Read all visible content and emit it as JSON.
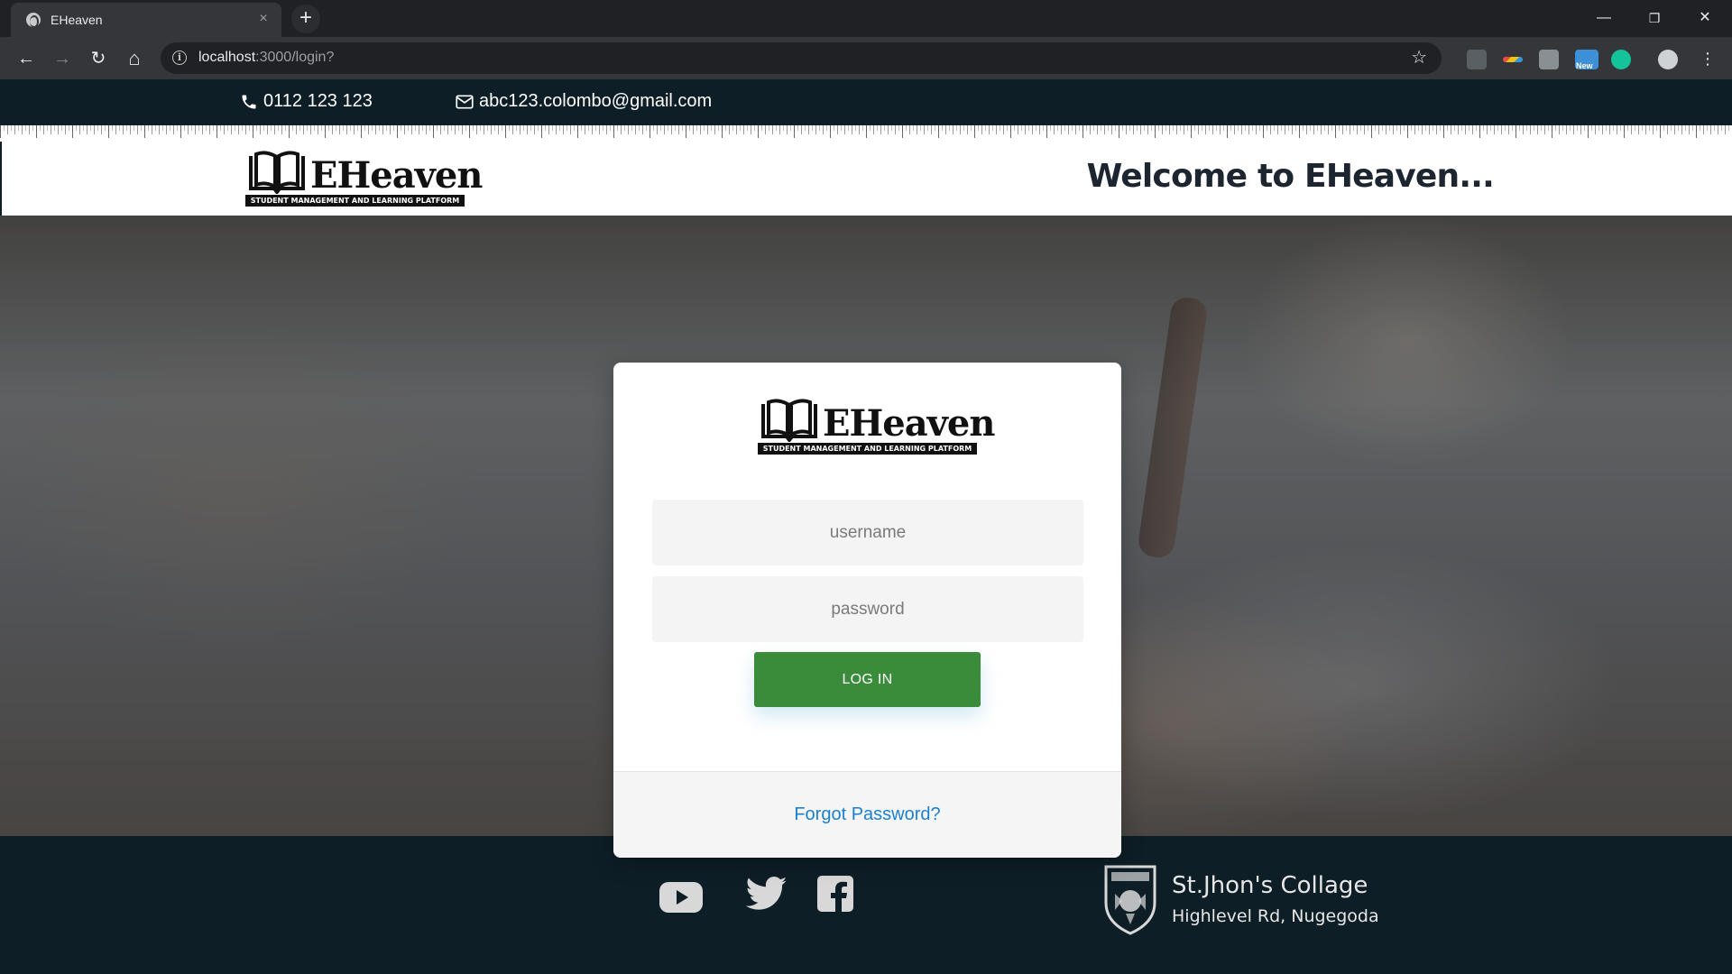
{
  "browser": {
    "tab_title": "EHeaven",
    "tab_close": "×",
    "new_tab": "+",
    "url_host": "localhost",
    "url_path": ":3000/login?",
    "window_controls": {
      "minimize": "—",
      "restore": "❐",
      "close": "✕"
    },
    "nav": {
      "back": "←",
      "forward": "→",
      "reload": "↻",
      "home": "⌂"
    },
    "extensions": [
      "selenium-ide-extension",
      "color-picker-extension",
      "clipboard-extension",
      "new-badge-extension",
      "grammarly-extension",
      "globe-extension"
    ],
    "new_badge": "New"
  },
  "contact": {
    "phone": "0112 123 123",
    "email": "abc123.colombo@gmail.com"
  },
  "header": {
    "logo_word": "EHeaven",
    "logo_tagline": "STUDENT MANAGEMENT AND LEARNING PLATFORM",
    "welcome": "Welcome to EHeaven..."
  },
  "login": {
    "logo_word": "EHeaven",
    "logo_tagline": "STUDENT MANAGEMENT AND LEARNING PLATFORM",
    "username_placeholder": "username",
    "password_placeholder": "password",
    "login_button": "LOG IN",
    "forgot_password": "Forgot Password?"
  },
  "footer": {
    "social": [
      "youtube-icon",
      "twitter-icon",
      "facebook-icon"
    ],
    "school_name": "St.Jhon's Collage",
    "school_address": "Highlevel Rd, Nugegoda"
  },
  "colors": {
    "dark_bar": "#0e1e26",
    "login_green": "#3a8c3b",
    "link_blue": "#1c7fd1"
  }
}
